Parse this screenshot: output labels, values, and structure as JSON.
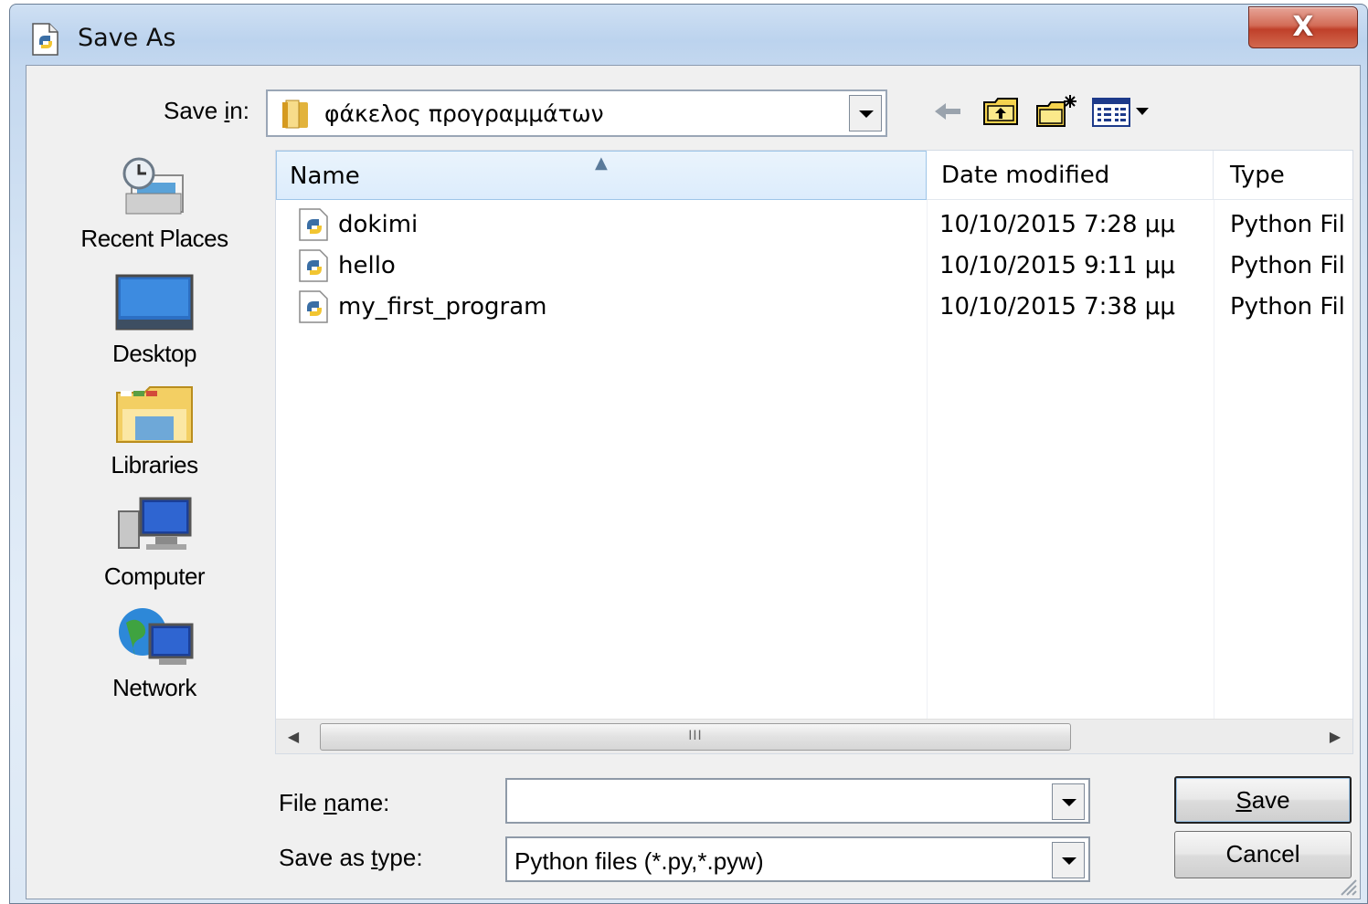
{
  "window": {
    "title": "Save As",
    "close_label": "X"
  },
  "toolbar": {
    "save_in_label_pre": "Save ",
    "save_in_label_key": "i",
    "save_in_label_post": "n:",
    "save_in_value": "φάκελος προγραμμάτων",
    "icons": [
      "back-arrow-icon",
      "up-folder-icon",
      "new-folder-icon",
      "view-menu-icon"
    ]
  },
  "places": [
    {
      "label": "Recent Places",
      "icon": "recent-places-icon"
    },
    {
      "label": "Desktop",
      "icon": "desktop-icon"
    },
    {
      "label": "Libraries",
      "icon": "libraries-icon"
    },
    {
      "label": "Computer",
      "icon": "computer-icon"
    },
    {
      "label": "Network",
      "icon": "network-icon"
    }
  ],
  "columns": {
    "name": "Name",
    "date": "Date modified",
    "type": "Type"
  },
  "files": [
    {
      "name": "dokimi",
      "date": "10/10/2015 7:28 μμ",
      "type": "Python Fil"
    },
    {
      "name": "hello",
      "date": "10/10/2015 9:11 μμ",
      "type": "Python Fil"
    },
    {
      "name": "my_first_program",
      "date": "10/10/2015 7:38 μμ",
      "type": "Python Fil"
    }
  ],
  "scrollbar": {
    "thumb_grip": "III"
  },
  "form": {
    "file_name_label_pre": "File ",
    "file_name_label_key": "n",
    "file_name_label_post": "ame:",
    "file_name_value": "",
    "save_type_label_pre": "Save as ",
    "save_type_label_key": "t",
    "save_type_label_post": "ype:",
    "save_type_value": "Python files (*.py,*.pyw)"
  },
  "buttons": {
    "save_key": "S",
    "save_rest": "ave",
    "cancel": "Cancel"
  }
}
